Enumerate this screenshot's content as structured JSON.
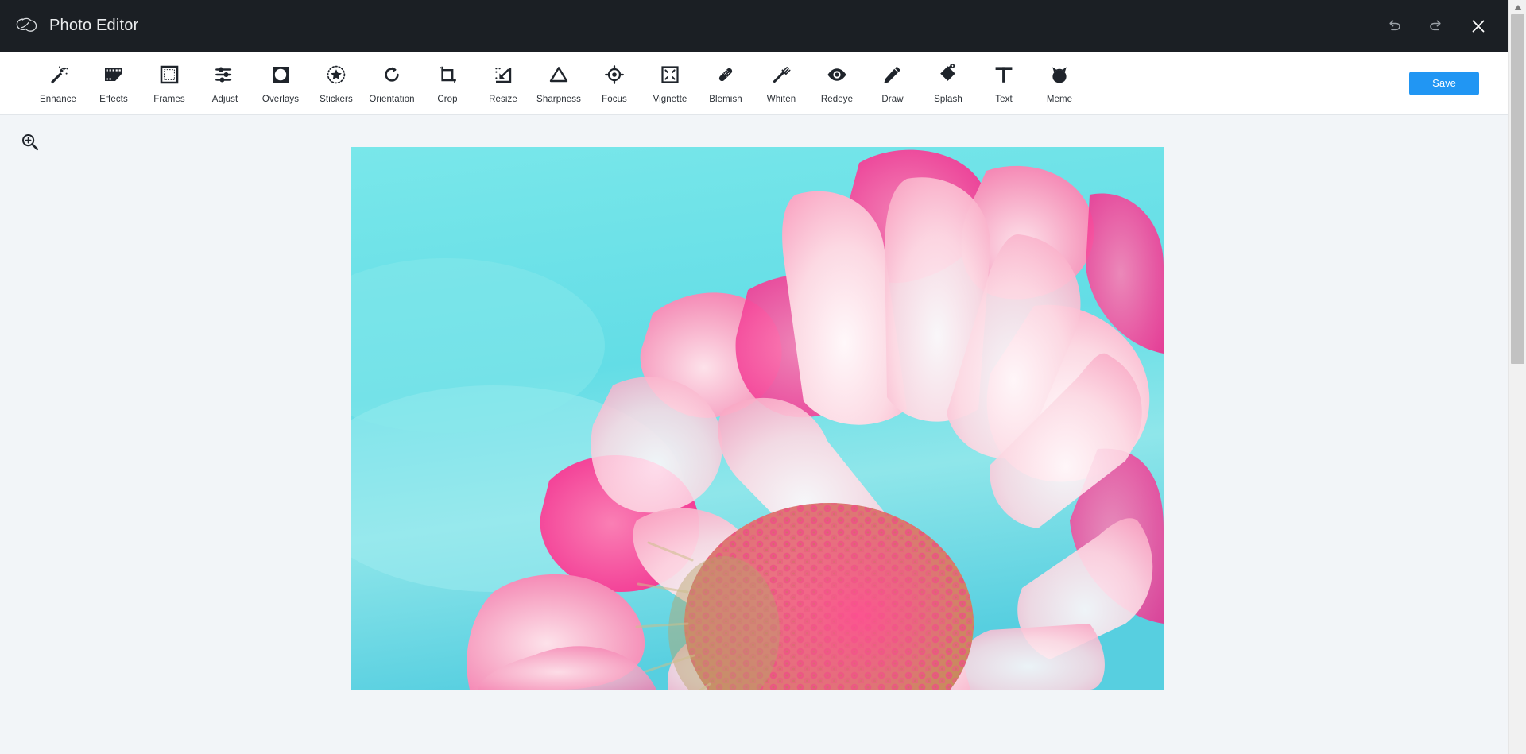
{
  "header": {
    "logo_icon": "creative-cloud-logo",
    "title": "Photo Editor",
    "undo_icon": "undo-icon",
    "redo_icon": "redo-icon",
    "close_icon": "close-icon"
  },
  "toolbar": {
    "save_label": "Save",
    "accent_color": "#2196f3",
    "tools": [
      {
        "label": "Enhance",
        "icon": "magic-wand-icon"
      },
      {
        "label": "Effects",
        "icon": "film-strip-icon"
      },
      {
        "label": "Frames",
        "icon": "square-frame-icon"
      },
      {
        "label": "Adjust",
        "icon": "sliders-icon"
      },
      {
        "label": "Overlays",
        "icon": "circle-in-square-icon"
      },
      {
        "label": "Stickers",
        "icon": "star-dotted-circle-icon"
      },
      {
        "label": "Orientation",
        "icon": "rotate-cw-icon"
      },
      {
        "label": "Crop",
        "icon": "crop-icon"
      },
      {
        "label": "Resize",
        "icon": "resize-arrow-icon"
      },
      {
        "label": "Sharpness",
        "icon": "triangle-icon"
      },
      {
        "label": "Focus",
        "icon": "target-crosshair-icon"
      },
      {
        "label": "Vignette",
        "icon": "corners-frame-icon"
      },
      {
        "label": "Blemish",
        "icon": "bandage-icon"
      },
      {
        "label": "Whiten",
        "icon": "toothbrush-icon"
      },
      {
        "label": "Redeye",
        "icon": "eye-icon"
      },
      {
        "label": "Draw",
        "icon": "pencil-icon"
      },
      {
        "label": "Splash",
        "icon": "paint-bucket-icon"
      },
      {
        "label": "Text",
        "icon": "text-t-icon"
      },
      {
        "label": "Meme",
        "icon": "cat-face-icon"
      }
    ]
  },
  "canvas": {
    "zoom_icon": "zoom-in-magnifier-icon",
    "photo": {
      "name": "pink-daisy-flower-photo",
      "background_color": "#6fe3e8",
      "petal_light_color": "#fbd3dd",
      "petal_mid_color": "#f892b8",
      "petal_deep_color": "#f0308c",
      "center_color": "#e2665f"
    }
  },
  "scrollbar": {
    "up_arrow_icon": "scroll-up-arrow-icon",
    "thumb_name": "vertical-scroll-thumb"
  }
}
